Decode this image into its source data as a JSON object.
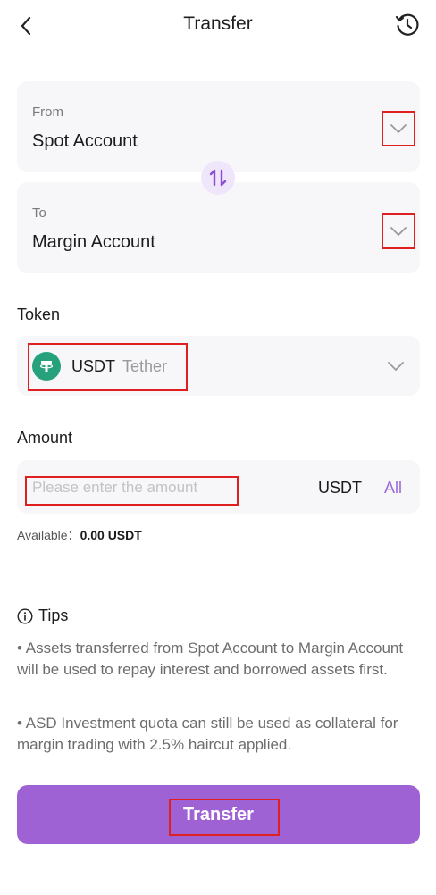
{
  "header": {
    "title": "Transfer",
    "back_icon": "chevron-left-icon",
    "history_icon": "history-clock-icon"
  },
  "from": {
    "label": "From",
    "value": "Spot Account"
  },
  "to": {
    "label": "To",
    "value": "Margin Account"
  },
  "swap_icon": "swap-arrows-icon",
  "token": {
    "label": "Token",
    "symbol": "USDT",
    "name": "Tether",
    "logo_color": "#26a17b"
  },
  "amount": {
    "label": "Amount",
    "placeholder": "Please enter the amount",
    "value": "",
    "unit": "USDT",
    "all_label": "All"
  },
  "available": {
    "label": "Available：",
    "value": "0.00 USDT"
  },
  "tips": {
    "title": "Tips",
    "items": [
      "• Assets transferred from Spot Account to Margin Account will be used to repay interest and borrowed assets first.",
      "• ASD Investment quota can still be used as collateral for margin trading with 2.5% haircut applied."
    ]
  },
  "submit": {
    "label": "Transfer"
  },
  "colors": {
    "accent": "#9f62d4",
    "highlight": "#e02020",
    "card_bg": "#f7f6f9"
  }
}
